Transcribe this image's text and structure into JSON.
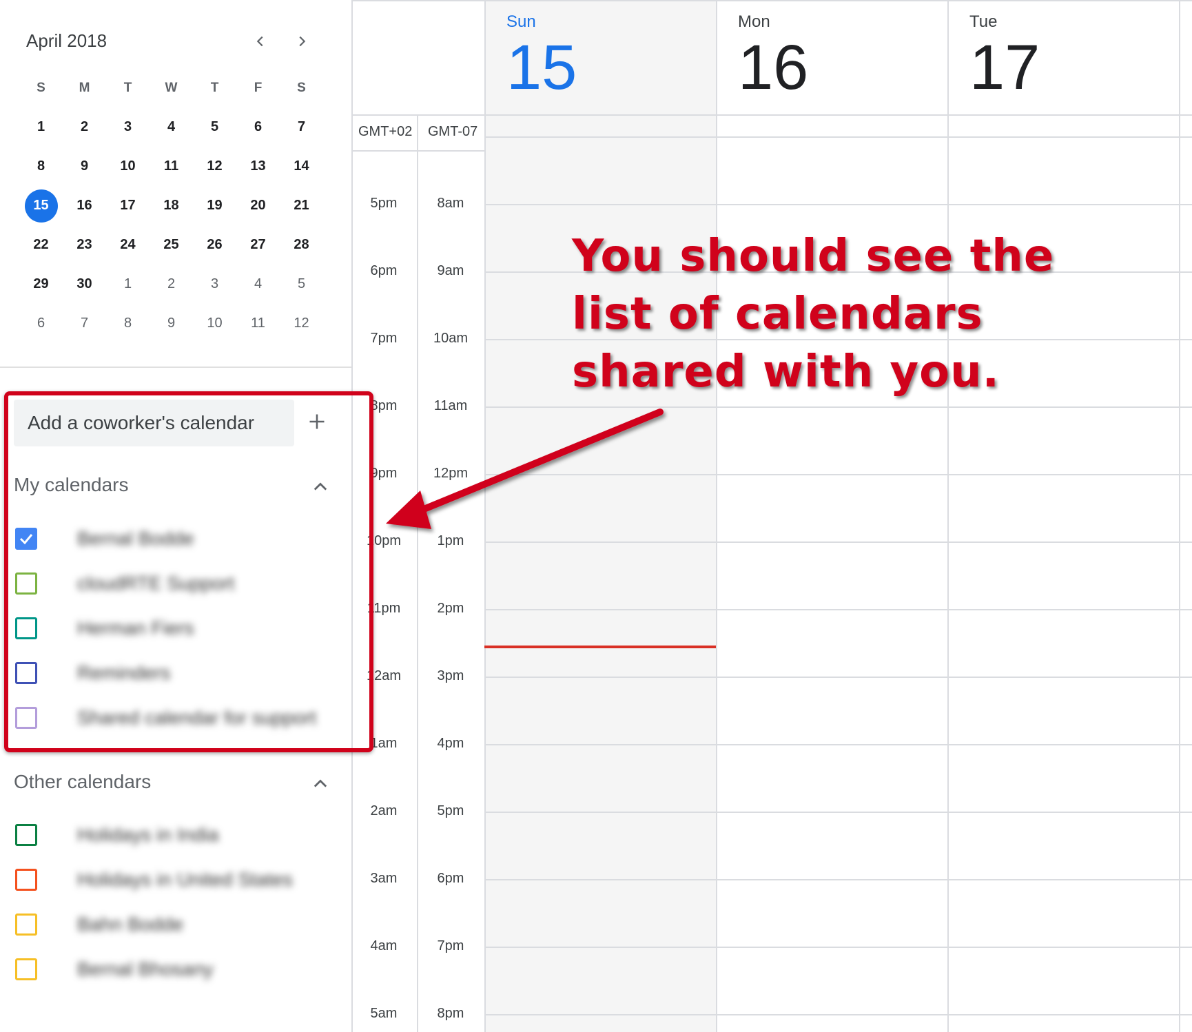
{
  "mini_calendar": {
    "title": "April 2018",
    "weekdays": [
      "S",
      "M",
      "T",
      "W",
      "T",
      "F",
      "S"
    ],
    "weeks": [
      [
        {
          "d": "1",
          "cur": true
        },
        {
          "d": "2",
          "cur": true
        },
        {
          "d": "3",
          "cur": true
        },
        {
          "d": "4",
          "cur": true
        },
        {
          "d": "5",
          "cur": true
        },
        {
          "d": "6",
          "cur": true
        },
        {
          "d": "7",
          "cur": true
        }
      ],
      [
        {
          "d": "8",
          "cur": true
        },
        {
          "d": "9",
          "cur": true
        },
        {
          "d": "10",
          "cur": true
        },
        {
          "d": "11",
          "cur": true
        },
        {
          "d": "12",
          "cur": true
        },
        {
          "d": "13",
          "cur": true
        },
        {
          "d": "14",
          "cur": true
        }
      ],
      [
        {
          "d": "15",
          "cur": true,
          "today": true
        },
        {
          "d": "16",
          "cur": true
        },
        {
          "d": "17",
          "cur": true
        },
        {
          "d": "18",
          "cur": true
        },
        {
          "d": "19",
          "cur": true
        },
        {
          "d": "20",
          "cur": true
        },
        {
          "d": "21",
          "cur": true
        }
      ],
      [
        {
          "d": "22",
          "cur": true
        },
        {
          "d": "23",
          "cur": true
        },
        {
          "d": "24",
          "cur": true
        },
        {
          "d": "25",
          "cur": true
        },
        {
          "d": "26",
          "cur": true
        },
        {
          "d": "27",
          "cur": true
        },
        {
          "d": "28",
          "cur": true
        }
      ],
      [
        {
          "d": "29",
          "cur": true
        },
        {
          "d": "30",
          "cur": true
        },
        {
          "d": "1",
          "cur": false
        },
        {
          "d": "2",
          "cur": false
        },
        {
          "d": "3",
          "cur": false
        },
        {
          "d": "4",
          "cur": false
        },
        {
          "d": "5",
          "cur": false
        }
      ],
      [
        {
          "d": "6",
          "cur": false
        },
        {
          "d": "7",
          "cur": false
        },
        {
          "d": "8",
          "cur": false
        },
        {
          "d": "9",
          "cur": false
        },
        {
          "d": "10",
          "cur": false
        },
        {
          "d": "11",
          "cur": false
        },
        {
          "d": "12",
          "cur": false
        }
      ]
    ]
  },
  "add_calendar": {
    "placeholder": "Add a coworker's calendar"
  },
  "my_calendars": {
    "label": "My calendars",
    "items": [
      {
        "name": "Bernal Bodde",
        "color": "#4285f4",
        "checked": true
      },
      {
        "name": "cloudRTE Support",
        "color": "#7cb342",
        "checked": false
      },
      {
        "name": "Herman Fiers",
        "color": "#009688",
        "checked": false
      },
      {
        "name": "Reminders",
        "color": "#3f51b5",
        "checked": false
      },
      {
        "name": "Shared calendar for support",
        "color": "#b39ddb",
        "checked": false
      }
    ]
  },
  "other_calendars": {
    "label": "Other calendars",
    "items": [
      {
        "name": "Holidays in India",
        "color": "#0b8043",
        "checked": false
      },
      {
        "name": "Holidays in United States",
        "color": "#f4511e",
        "checked": false
      },
      {
        "name": "Bahn Bodde",
        "color": "#f6bf26",
        "checked": false
      },
      {
        "name": "Bernal Bhosany",
        "color": "#f6bf26",
        "checked": false
      }
    ]
  },
  "day_headers": [
    {
      "name": "Sun",
      "num": "15",
      "today": true
    },
    {
      "name": "Mon",
      "num": "16",
      "today": false
    },
    {
      "name": "Tue",
      "num": "17",
      "today": false
    }
  ],
  "timezones": [
    "GMT+02",
    "GMT-07"
  ],
  "time_rows": [
    {
      "primary": "5pm",
      "secondary": "8am"
    },
    {
      "primary": "6pm",
      "secondary": "9am"
    },
    {
      "primary": "7pm",
      "secondary": "10am"
    },
    {
      "primary": "8pm",
      "secondary": "11am"
    },
    {
      "primary": "9pm",
      "secondary": "12pm"
    },
    {
      "primary": "10pm",
      "secondary": "1pm"
    },
    {
      "primary": "11pm",
      "secondary": "2pm"
    },
    {
      "primary": "12am",
      "secondary": "3pm"
    },
    {
      "primary": "1am",
      "secondary": "4pm"
    },
    {
      "primary": "2am",
      "secondary": "5pm"
    },
    {
      "primary": "3am",
      "secondary": "6pm"
    },
    {
      "primary": "4am",
      "secondary": "7pm"
    },
    {
      "primary": "5am",
      "secondary": "8pm"
    }
  ],
  "annotation": {
    "lines": [
      "You should see the",
      "list of calendars",
      "shared with you."
    ],
    "color": "#d0021b"
  },
  "colors": {
    "accent": "#1a73e8",
    "today_text": "#1a73e8",
    "now_line": "#d93025"
  }
}
